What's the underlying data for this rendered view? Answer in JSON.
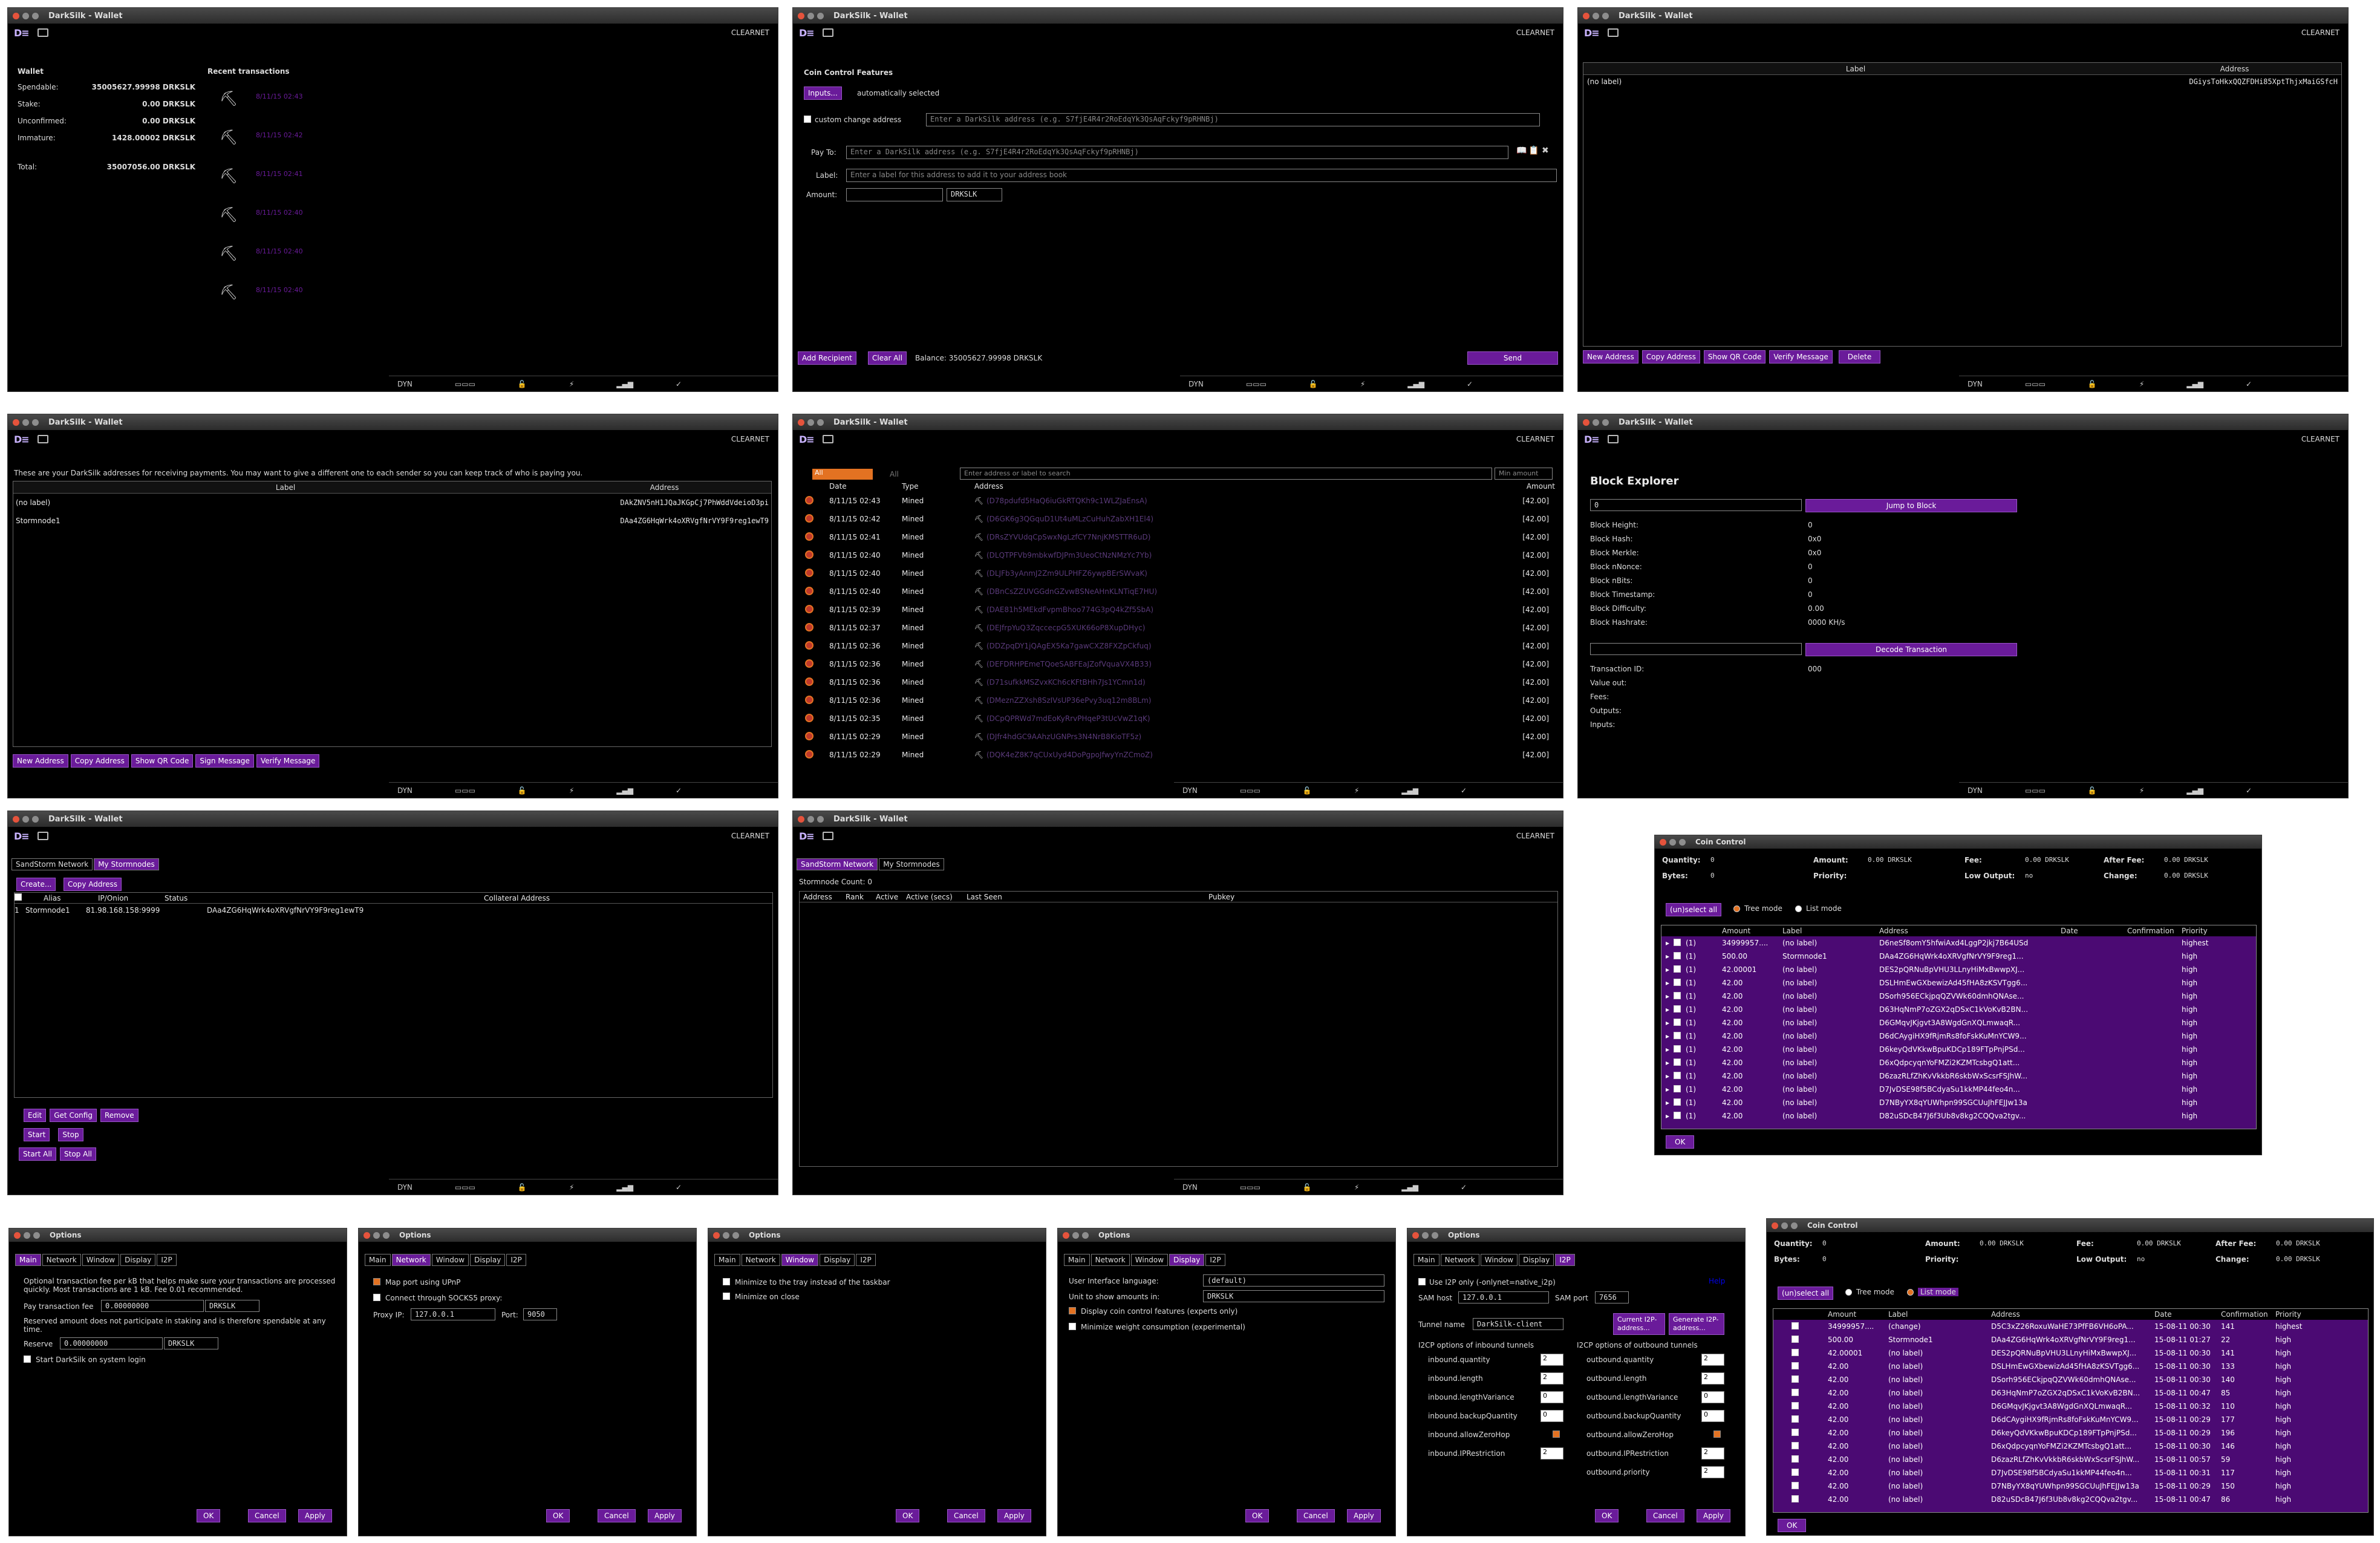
{
  "title": "DarkSilk - Wallet",
  "clearnet": "CLEARNET",
  "dyn": "DYN",
  "overview": {
    "wallet_label": "Wallet",
    "recent_label": "Recent transactions",
    "rows": [
      [
        "Spendable:",
        "35005627.99998 DRKSLK"
      ],
      [
        "Stake:",
        "0.00 DRKSLK"
      ],
      [
        "Unconfirmed:",
        "0.00 DRKSLK"
      ],
      [
        "Immature:",
        "1428.00002 DRKSLK"
      ],
      [
        "Total:",
        "35007056.00 DRKSLK"
      ]
    ],
    "tx_dates": [
      "8/11/15 02:43",
      "8/11/15 02:42",
      "8/11/15 02:41",
      "8/11/15 02:40",
      "8/11/15 02:40",
      "8/11/15 02:40"
    ]
  },
  "send": {
    "heading": "Coin Control Features",
    "inputs_btn": "Inputs...",
    "auto": "automatically selected",
    "custom_change": "custom change address",
    "address_ph": "Enter a DarkSilk address (e.g. S7fjE4R4r2RoEdqYk3QsAqFckyf9pRHNBj)",
    "payto": "Pay To:",
    "label": "Label:",
    "label_ph": "Enter a label for this address to add it to your address book",
    "amount": "Amount:",
    "unit": "DRKSLK",
    "add_recipient": "Add Recipient",
    "clear_all": "Clear All",
    "balance": "Balance: 35005627.99998 DRKSLK",
    "send_btn": "Send"
  },
  "addressbook": {
    "col_label": "Label",
    "col_address": "Address",
    "rows": [
      [
        "(no label)",
        "DGiysToHkxQQZFDHi85XptThjxMaiGSfcH"
      ]
    ],
    "buttons": [
      "New Address",
      "Copy Address",
      "Show QR Code",
      "Verify Message",
      "Delete"
    ]
  },
  "receive": {
    "desc": "These are your DarkSilk addresses for receiving payments. You may want to give a different one to each sender so you can keep track of who is paying you.",
    "col_label": "Label",
    "col_address": "Address",
    "rows": [
      [
        "(no label)",
        "DAkZNV5nH1JQaJKGpCj7PhWddVdeioD3pi"
      ],
      [
        "Stormnode1",
        "DAa4ZG6HqWrk4oXRVgfNrVY9F9reg1ewT9"
      ]
    ],
    "buttons": [
      "New Address",
      "Copy Address",
      "Show QR Code",
      "Sign Message",
      "Verify Message"
    ]
  },
  "history": {
    "filter_all": "All",
    "filter_all2": "All",
    "search_ph": "Enter address or label to search",
    "min_ph": "Min amount",
    "cols": [
      "Date",
      "Type",
      "Address",
      "Amount"
    ],
    "rows": [
      [
        "8/11/15 02:43",
        "Mined",
        "(D78pdufd5HaQ6iuGkRTQKh9c1WLZJaEnsA)",
        "[42.00]"
      ],
      [
        "8/11/15 02:42",
        "Mined",
        "(D6GK6g3QGquD1Ut4uMLzCuHuhZabXH1El4)",
        "[42.00]"
      ],
      [
        "8/11/15 02:41",
        "Mined",
        "(DRsZYVUdqCpSwxNgLzfCY7NnjKMSTTR6uD)",
        "[42.00]"
      ],
      [
        "8/11/15 02:40",
        "Mined",
        "(DLQTPFVb9mbkwfDJPm3UeoCtNzNMzYc7Yb)",
        "[42.00]"
      ],
      [
        "8/11/15 02:40",
        "Mined",
        "(DLJFb3yAnmJ2Zm9ULPHFZ6ywpBErSWvaK)",
        "[42.00]"
      ],
      [
        "8/11/15 02:40",
        "Mined",
        "(DBnCsZZUVGGdnGZvwBSNeAHnKLNTiqE7HU)",
        "[42.00]"
      ],
      [
        "8/11/15 02:39",
        "Mined",
        "(DAE81h5MEkdFvpmBhoo774G3pQ4kZf5SbA)",
        "[42.00]"
      ],
      [
        "8/11/15 02:37",
        "Mined",
        "(DEJfrpYuQ3ZqccecpG5XUK66oP8XupDHyc)",
        "[42.00]"
      ],
      [
        "8/11/15 02:36",
        "Mined",
        "(DDZpqDY1jQAgEX5Ka7gawCXZ8FXZpCkfuq)",
        "[42.00]"
      ],
      [
        "8/11/15 02:36",
        "Mined",
        "(DEFDRHPEmeTQoeSABFEaJZofVquaVX4B33)",
        "[42.00]"
      ],
      [
        "8/11/15 02:36",
        "Mined",
        "(D71sufkkMSZvxKCh6cKFtBHh7Js1YCmn1d)",
        "[42.00]"
      ],
      [
        "8/11/15 02:36",
        "Mined",
        "(DMeznZZXsh8SzIVsUP36ePvy3uq12m8BLm)",
        "[42.00]"
      ],
      [
        "8/11/15 02:35",
        "Mined",
        "(DCpQPRWd7mdEoKyRrvPHqeP3tUcVwZ1qK)",
        "[42.00]"
      ],
      [
        "8/11/15 02:29",
        "Mined",
        "(DJfr4hdGC9AAhzUGNPrs3N4NrB8KioTF5z)",
        "[42.00]"
      ],
      [
        "8/11/15 02:29",
        "Mined",
        "(DQK4eZ8K7qCUxUyd4DoPgpoJfwyYnZCmoZ)",
        "[42.00]"
      ]
    ]
  },
  "explorer": {
    "heading": "Block Explorer",
    "height_val": "0",
    "jump_btn": "Jump to Block",
    "fields": [
      [
        "Block Height:",
        "0"
      ],
      [
        "Block Hash:",
        "0x0"
      ],
      [
        "Block Merkle:",
        "0x0"
      ],
      [
        "Block nNonce:",
        "0"
      ],
      [
        "Block nBits:",
        "0"
      ],
      [
        "Block Timestamp:",
        "0"
      ],
      [
        "Block Difficulty:",
        "0.00"
      ],
      [
        "Block Hashrate:",
        "0000 KH/s"
      ]
    ],
    "decode_btn": "Decode Transaction",
    "tx_fields": [
      [
        "Transaction ID:",
        "000"
      ],
      [
        "Value out:",
        ""
      ],
      [
        "Fees:",
        ""
      ],
      [
        "Outputs:",
        ""
      ],
      [
        "Inputs:",
        ""
      ]
    ]
  },
  "stormnodes1": {
    "tabs": [
      "SandStorm Network",
      "My Stormnodes"
    ],
    "create": "Create...",
    "copy": "Copy Address",
    "cols": [
      "Alias",
      "IP/Onion",
      "Status",
      "Collateral Address"
    ],
    "row": [
      "1",
      "Stormnode1",
      "81.98.168.158:9999",
      "",
      "DAa4ZG6HqWrk4oXRVgfNrVY9F9reg1ewT9"
    ],
    "buttons1": [
      "Edit",
      "Get Config",
      "Remove"
    ],
    "buttons2": [
      "Start",
      "Stop"
    ],
    "buttons3": [
      "Start All",
      "Stop All"
    ]
  },
  "stormnodes2": {
    "tabs": [
      "SandStorm Network",
      "My Stormnodes"
    ],
    "count": "Stormnode Count: 0",
    "cols": [
      "Address",
      "Rank",
      "Active",
      "Active (secs)",
      "Last Seen",
      "Pubkey"
    ]
  },
  "coincontrol": {
    "title": "Coin Control",
    "stats": [
      [
        "Quantity:",
        "0"
      ],
      [
        "Amount:",
        "0.00 DRKSLK"
      ],
      [
        "Fee:",
        "0.00 DRKSLK"
      ],
      [
        "After Fee:",
        "0.00 DRKSLK"
      ],
      [
        "Bytes:",
        "0"
      ],
      [
        "Priority:",
        ""
      ],
      [
        "Low Output:",
        "no"
      ],
      [
        "Change:",
        "0.00 DRKSLK"
      ]
    ],
    "unselect": "(un)select all",
    "tree": "Tree mode",
    "list": "List mode",
    "cols": [
      "Amount",
      "Label",
      "Address",
      "Date",
      "Confirmation",
      "Priority"
    ],
    "rows": [
      [
        "(1)",
        "34999957....",
        "(no label)",
        "D6neSf8omY5hfwiAxd4LggP2jkj7B64USd",
        "",
        "",
        "highest"
      ],
      [
        "(1)",
        "500.00",
        "Stormnode1",
        "DAa4ZG6HqWrk4oXRVgfNrVY9F9reg1...",
        "",
        "",
        "high"
      ],
      [
        "(1)",
        "42.00001",
        "(no label)",
        "DES2pQRNuBpVHU3LLnyHiMxBwwpXJ...",
        "",
        "",
        "high"
      ],
      [
        "(1)",
        "42.00",
        "(no label)",
        "DSLHmEwGXbewizAd45fHA8zKSVTgg6...",
        "",
        "",
        "high"
      ],
      [
        "(1)",
        "42.00",
        "(no label)",
        "DSorh956ECkjpqQZVWk60dmhQNAse...",
        "",
        "",
        "high"
      ],
      [
        "(1)",
        "42.00",
        "(no label)",
        "D63HqNmP7oZGX2qDSxC1kVoKvB2BN...",
        "",
        "",
        "high"
      ],
      [
        "(1)",
        "42.00",
        "(no label)",
        "D6GMqvJKjgvt3A8WgdGnXQLmwaqR...",
        "",
        "",
        "high"
      ],
      [
        "(1)",
        "42.00",
        "(no label)",
        "D6dCAygiHX9fRjmRs8foFskKuMnYCW9...",
        "",
        "",
        "high"
      ],
      [
        "(1)",
        "42.00",
        "(no label)",
        "D6keyQdVKkwBpuKDCp189FTpPnjPSd...",
        "",
        "",
        "high"
      ],
      [
        "(1)",
        "42.00",
        "(no label)",
        "D6xQdpcyqnYoFMZi2KZMTcsbgQ1att...",
        "",
        "",
        "high"
      ],
      [
        "(1)",
        "42.00",
        "(no label)",
        "D6zazRLfZhKvVkkbR6skbWxScsrFSJhW...",
        "",
        "",
        "high"
      ],
      [
        "(1)",
        "42.00",
        "(no label)",
        "D7JvDSE98f5BCdyaSu1kkMP44feo4n...",
        "",
        "",
        "high"
      ],
      [
        "(1)",
        "42.00",
        "(no label)",
        "D7NByYX8qYUWhpn99SGCUuJhFEJJw13a",
        "",
        "",
        "high"
      ],
      [
        "(1)",
        "42.00",
        "(no label)",
        "D82uSDcB47J6f3Ub8v8kg2CQQva2tgv...",
        "",
        "",
        "high"
      ]
    ],
    "ok": "OK"
  },
  "coincontrol2": {
    "title": "Coin Control",
    "stats": [
      [
        "Quantity:",
        "0"
      ],
      [
        "Amount:",
        "0.00 DRKSLK"
      ],
      [
        "Fee:",
        "0.00 DRKSLK"
      ],
      [
        "After Fee:",
        "0.00 DRKSLK"
      ],
      [
        "Bytes:",
        "0"
      ],
      [
        "Priority:",
        ""
      ],
      [
        "Low Output:",
        "no"
      ],
      [
        "Change:",
        "0.00 DRKSLK"
      ]
    ],
    "unselect": "(un)select all",
    "tree": "Tree mode",
    "list": "List mode",
    "cols": [
      "Amount",
      "Label",
      "Address",
      "Date",
      "Confirmation",
      "Priority"
    ],
    "rows": [
      [
        "34999957....",
        "(change)",
        "D5C3xZ26RoxuWaHE73PfFB6VH6oPA...",
        "15-08-11 00:30",
        "141",
        "highest"
      ],
      [
        "500.00",
        "Stormnode1",
        "DAa4ZG6HqWrk4oXRVgfNrVY9F9reg1...",
        "15-08-11 01:27",
        "22",
        "high"
      ],
      [
        "42.00001",
        "(no label)",
        "DES2pQRNuBpVHU3LLnyHiMxBwwpXJ...",
        "15-08-11 00:30",
        "141",
        "high"
      ],
      [
        "42.00",
        "(no label)",
        "DSLHmEwGXbewizAd45fHA8zKSVTgg6...",
        "15-08-11 00:30",
        "133",
        "high"
      ],
      [
        "42.00",
        "(no label)",
        "DSorh956ECkjpqQZVWk60dmhQNAse...",
        "15-08-11 00:30",
        "140",
        "high"
      ],
      [
        "42.00",
        "(no label)",
        "D63HqNmP7oZGX2qDSxC1kVoKvB2BN...",
        "15-08-11 00:47",
        "85",
        "high"
      ],
      [
        "42.00",
        "(no label)",
        "D6GMqvJKjgvt3A8WgdGnXQLmwaqR...",
        "15-08-11 00:32",
        "110",
        "high"
      ],
      [
        "42.00",
        "(no label)",
        "D6dCAygiHX9fRjmRs8foFskKuMnYCW9...",
        "15-08-11 00:29",
        "177",
        "high"
      ],
      [
        "42.00",
        "(no label)",
        "D6keyQdVKkwBpuKDCp189FTpPnjPSd...",
        "15-08-11 00:29",
        "196",
        "high"
      ],
      [
        "42.00",
        "(no label)",
        "D6xQdpcyqnYoFMZi2KZMTcsbgQ1att...",
        "15-08-11 00:30",
        "146",
        "high"
      ],
      [
        "42.00",
        "(no label)",
        "D6zazRLfZhKvVkkbR6skbWxScsrFSJhW...",
        "15-08-11 00:57",
        "59",
        "high"
      ],
      [
        "42.00",
        "(no label)",
        "D7JvDSE98f5BCdyaSu1kkMP44feo4n...",
        "15-08-11 00:31",
        "117",
        "high"
      ],
      [
        "42.00",
        "(no label)",
        "D7NByYX8qYUWhpn99SGCUuJhFEJJw13a",
        "15-08-11 00:29",
        "150",
        "high"
      ],
      [
        "42.00",
        "(no label)",
        "D82uSDcB47J6f3Ub8v8kg2CQQva2tgv...",
        "15-08-11 00:47",
        "86",
        "high"
      ]
    ],
    "ok": "OK"
  },
  "options": {
    "title": "Options",
    "tabs": [
      "Main",
      "Network",
      "Window",
      "Display",
      "I2P"
    ],
    "ok": "OK",
    "cancel": "Cancel",
    "apply": "Apply",
    "main": {
      "desc": "Optional transaction fee per kB that helps make sure your transactions are processed quickly. Most transactions are 1 kB. Fee 0.01 recommended.",
      "fee_label": "Pay transaction fee",
      "fee_val": "0.00000000",
      "unit": "DRKSLK",
      "reserve_desc": "Reserved amount does not participate in staking and is therefore spendable at any time.",
      "reserve_label": "Reserve",
      "reserve_val": "0.00000000",
      "start": "Start DarkSilk on system login"
    },
    "network": {
      "upnp": "Map port using UPnP",
      "socks": "Connect through SOCKS5 proxy:",
      "proxy_ip": "Proxy IP:",
      "ip_val": "127.0.0.1",
      "port": "Port:",
      "port_val": "9050"
    },
    "window": {
      "tray": "Minimize to the tray instead of the taskbar",
      "close": "Minimize on close"
    },
    "display": {
      "lang": "User Interface language:",
      "lang_val": "(default)",
      "unit": "Unit to show amounts in:",
      "unit_val": "DRKSLK",
      "coin": "Display coin control features (experts only)",
      "weight": "Minimize weight consumption (experimental)"
    },
    "i2p": {
      "only": "Use I2P only (-onlynet=native_i2p)",
      "help": "Help",
      "sam_host": "SAM host",
      "host_val": "127.0.0.1",
      "sam_port": "SAM port",
      "port_val": "7656",
      "tunnel": "Tunnel name",
      "tunnel_val": "DarkSilk-client",
      "current": "Current I2P-address...",
      "generate": "Generate I2P-address...",
      "in_head": "I2CP options of inbound tunnels",
      "out_head": "I2CP options of outbound tunnels",
      "in": [
        [
          "inbound.quantity",
          "2"
        ],
        [
          "inbound.length",
          "2"
        ],
        [
          "inbound.lengthVariance",
          "0"
        ],
        [
          "inbound.backupQuantity",
          "0"
        ],
        [
          "inbound.allowZeroHop",
          ""
        ],
        [
          "inbound.IPRestriction",
          "2"
        ]
      ],
      "out": [
        [
          "outbound.quantity",
          "2"
        ],
        [
          "outbound.length",
          "2"
        ],
        [
          "outbound.lengthVariance",
          "0"
        ],
        [
          "outbound.backupQuantity",
          "0"
        ],
        [
          "outbound.allowZeroHop",
          ""
        ],
        [
          "outbound.IPRestriction",
          "2"
        ],
        [
          "outbound.priority",
          "2"
        ]
      ]
    }
  }
}
